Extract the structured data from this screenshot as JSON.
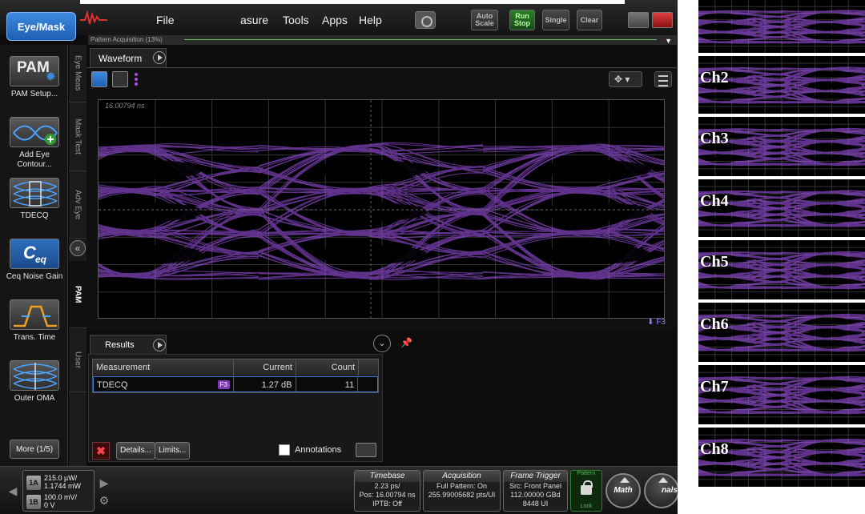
{
  "menubar": {
    "brand_button": "Eye/Mask",
    "menu": [
      "File",
      "asure",
      "Tools",
      "Apps",
      "Help"
    ],
    "buttons": {
      "auto_scale": "Auto Scale",
      "run_stop": "Run Stop",
      "single": "Single",
      "clear": "Clear"
    }
  },
  "acquisition": {
    "label": "Pattern Acquisition",
    "percent": "(13%)"
  },
  "toolpanel": {
    "tools": [
      {
        "label": "PAM Setup...",
        "icon": "pam-setup-icon",
        "glyph": "PAM"
      },
      {
        "label": "Add Eye Contour...",
        "icon": "add-eye-contour-icon"
      },
      {
        "label": "TDECQ",
        "icon": "tdecq-icon"
      },
      {
        "label": "Ceq Noise Gain",
        "icon": "ceq-icon",
        "glyph": "C",
        "glyph_sub": "eq"
      },
      {
        "label": "Trans. Time",
        "icon": "transition-time-icon"
      },
      {
        "label": "Outer OMA",
        "icon": "outer-oma-icon"
      }
    ],
    "more": "More (1/5)"
  },
  "vtabs": [
    "Eye Meas",
    "Mask Test",
    "Adv Eye",
    "PAM",
    "User"
  ],
  "waveform": {
    "tab": "Waveform",
    "timestamp": "16.00794 ns",
    "marker": "F3"
  },
  "results": {
    "tab": "Results",
    "columns": [
      "Measurement",
      "Current",
      "Count"
    ],
    "rows": [
      {
        "measurement": "TDECQ",
        "badge": "F3",
        "current": "1.27 dB",
        "count": "11"
      }
    ],
    "details": "Details...",
    "limits": "Limits...",
    "annotations": "Annotations"
  },
  "status": {
    "ch1": {
      "badge": "1A",
      "line1": "215.0 µW/",
      "line2": "1.1744 mW"
    },
    "ch2": {
      "badge": "1B",
      "line1": "100.0 mV/",
      "line2": "0 V"
    },
    "timebase": {
      "title": "Timebase",
      "lines": [
        "2.23 ps/",
        "Pos: 16.00794 ns",
        "IPTB: Off"
      ]
    },
    "acquisition": {
      "title": "Acquisition",
      "lines": [
        "Full Pattern: On",
        "255.99005682 pts/UI"
      ]
    },
    "trigger": {
      "title": "Frame Trigger",
      "lines": [
        "Src: Front Panel",
        "112.00000 GBd",
        "8448 UI"
      ]
    },
    "pattern_lock": {
      "top": "Pattern",
      "bottom": "Lock"
    },
    "math": "Math",
    "signals": "nals"
  },
  "channels": [
    "Ch2",
    "Ch3",
    "Ch4",
    "Ch5",
    "Ch6",
    "Ch7",
    "Ch8"
  ],
  "colors": {
    "eye": "#b05cff",
    "accent": "#3c8ae0",
    "run": "#2f7d2f"
  }
}
